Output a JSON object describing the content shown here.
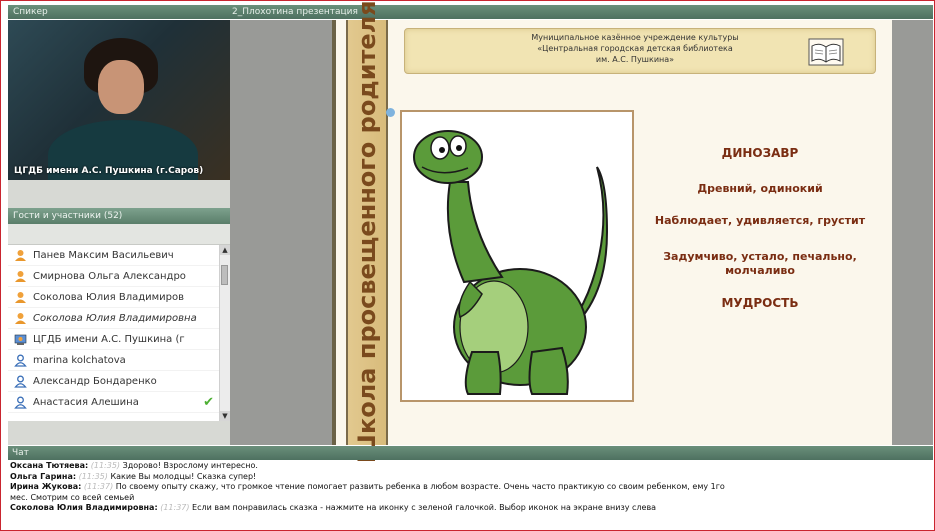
{
  "panels": {
    "speaker_title": "Спикер",
    "presentation_title": "2_Плохотина презентация",
    "guests_title": "Гости и участники (52)",
    "chat_title": "Чат"
  },
  "video": {
    "caption": "ЦГДБ имени А.С. Пушкина (г.Саров)"
  },
  "guests": [
    {
      "name": "Панев Максим Васильевич",
      "icon": "guest-user-icon",
      "italic": false,
      "checked": false
    },
    {
      "name": "Смирнова Ольга Александро",
      "icon": "guest-user-icon",
      "italic": false,
      "checked": false
    },
    {
      "name": "Соколова Юлия Владимиров",
      "icon": "guest-user-icon",
      "italic": false,
      "checked": false
    },
    {
      "name": "Соколова Юлия Владимировна",
      "icon": "guest-user-icon",
      "italic": true,
      "checked": false
    },
    {
      "name": "ЦГДБ имени А.С. Пушкина (г",
      "icon": "presenter-icon",
      "italic": false,
      "checked": false
    },
    {
      "name": "marina kolchatova",
      "icon": "participant-icon",
      "italic": false,
      "checked": false
    },
    {
      "name": "Александр Бондаренко",
      "icon": "participant-icon",
      "italic": false,
      "checked": false
    },
    {
      "name": "Анастасия Алешина",
      "icon": "participant-icon",
      "italic": false,
      "checked": true
    }
  ],
  "slide": {
    "vertical_title": "Школа просвещенного родителя",
    "banner_line1": "Муниципальное казённое учреждение культуры",
    "banner_line2": "«Центральная городская детская библиотека",
    "banner_line3": "им. А.С. Пушкина»",
    "word1": "ДИНОЗАВР",
    "word2": "Древний,  одинокий",
    "word3": "Наблюдает, удивляется, грустит",
    "word4": "Задумчиво, устало, печально,",
    "word5": "молчаливо",
    "word6": "МУДРОСТЬ"
  },
  "chat": [
    {
      "author": "Оксана Тютяева:",
      "time": "(11:35)",
      "text": "Здорово! Взрослому интересно."
    },
    {
      "author": "Ольга Гарина:",
      "time": "(11:35)",
      "text": "Какие Вы молодцы! Сказка супер!"
    },
    {
      "author": "Ирина Жукова:",
      "time": "(11:37)",
      "text": "По своему опыту скажу, что громкое чтение помогает развить ребенка в любом возрасте. Очень часто практикую со своим ребенком, ему 1го"
    },
    {
      "author": "",
      "time": "",
      "text": "мес. Смотрим со всей семьей"
    },
    {
      "author": "Соколова Юлия Владимировна:",
      "time": "(11:37)",
      "text": "Если вам понравилась сказка - нажмите на иконку с зеленой галочкой. Выбор иконок на экране внизу слева"
    }
  ]
}
